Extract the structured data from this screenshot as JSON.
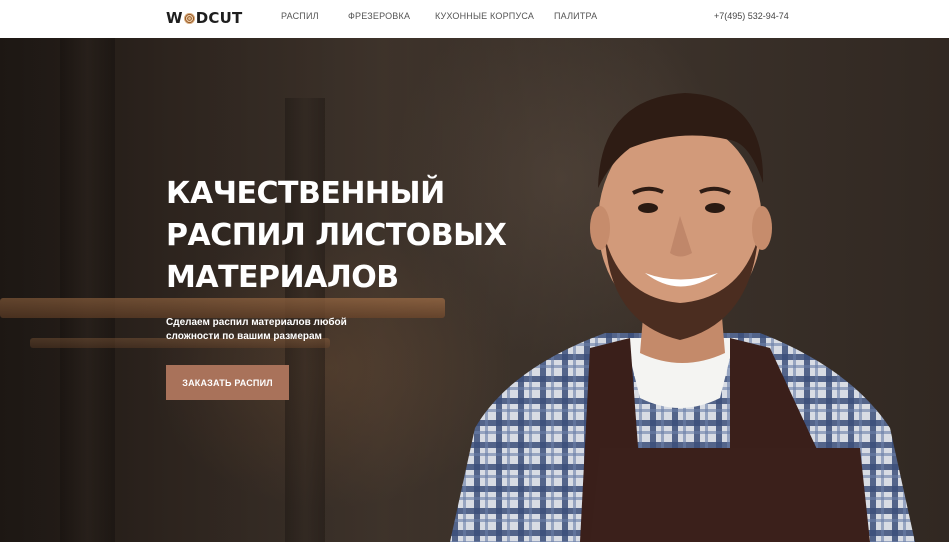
{
  "header": {
    "logo": {
      "before": "W",
      "after": "DCUT"
    },
    "nav": [
      "РАСПИЛ",
      "ФРЕЗЕРОВКА",
      "КУХОННЫЕ КОРПУСА",
      "ПАЛИТРА"
    ],
    "phone": "+7(495) 532-94-74"
  },
  "hero": {
    "title": "КАЧЕСТВЕННЫЙ РАСПИЛ ЛИСТОВЫХ МАТЕРИАЛОВ",
    "subtitle": "Сделаем распил материалов любой сложности по вашим размерам",
    "cta_label": "ЗАКАЗАТЬ РАСПИЛ",
    "image_icon": "carpenter-photo"
  },
  "colors": {
    "accent": "#a9725a",
    "nav_bg": "#ffffff",
    "hero_text": "#ffffff"
  }
}
